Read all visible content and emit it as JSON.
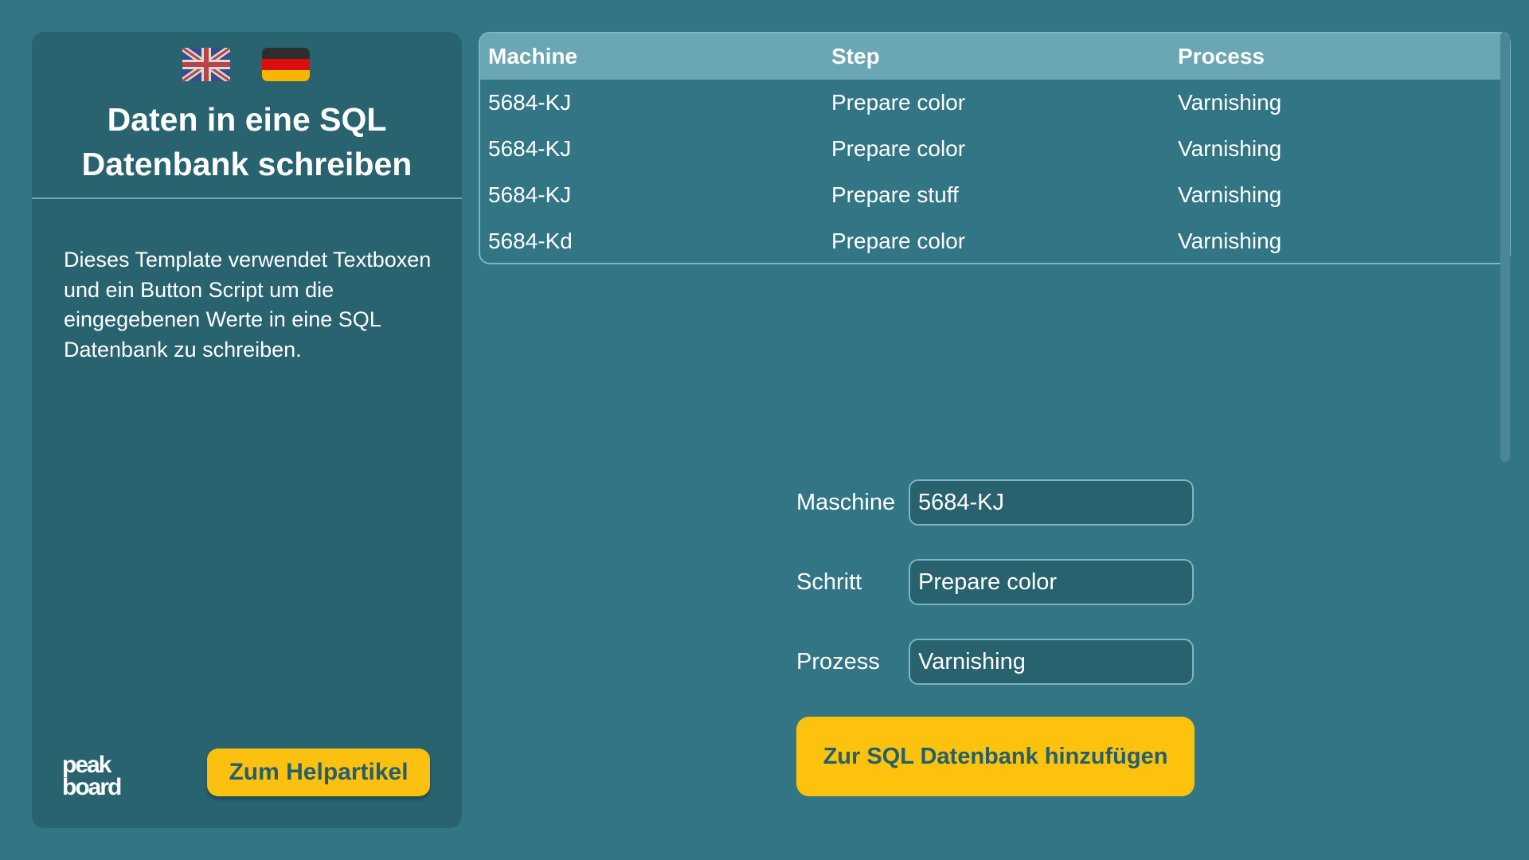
{
  "sidebar": {
    "languages": [
      "English",
      "Deutsch"
    ],
    "title": "Daten in eine SQL Datenbank schreiben",
    "description": "Dieses Template verwendet Textboxen und ein Button Script um die eingegebenen Werte in eine SQL Datenbank zu schreiben.",
    "logo_text": "peak board",
    "help_button_label": "Zum Helpartikel"
  },
  "table": {
    "columns": [
      "Machine",
      "Step",
      "Process"
    ],
    "rows": [
      [
        "5684-KJ",
        "Prepare color",
        "Varnishing"
      ],
      [
        "5684-KJ",
        "Prepare color",
        "Varnishing"
      ],
      [
        "5684-KJ",
        "Prepare stuff",
        "Varnishing"
      ],
      [
        "5684-Kd",
        "Prepare color",
        "Varnishing"
      ]
    ]
  },
  "form": {
    "machine_label": "Maschine",
    "machine_value": "5684-KJ",
    "step_label": "Schritt",
    "step_value": "Prepare color",
    "process_label": "Prozess",
    "process_value": "Varnishing",
    "submit_label": "Zur SQL Datenbank hinzufügen"
  },
  "colors": {
    "background": "#327686",
    "panel": "#28636f",
    "accent": "#fcc110",
    "table_header": "#6aa6b4",
    "border": "#7fb4c2"
  }
}
